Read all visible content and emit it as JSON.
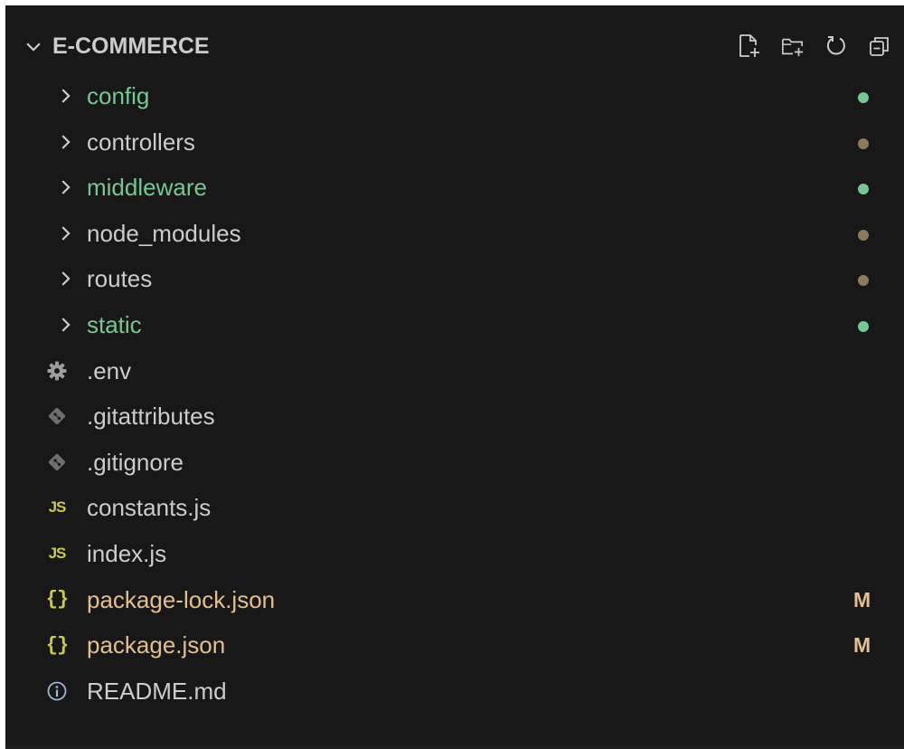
{
  "explorer": {
    "section_title": "E-COMMERCE",
    "actions": [
      {
        "name": "new-file-icon",
        "label": "New File"
      },
      {
        "name": "new-folder-icon",
        "label": "New Folder"
      },
      {
        "name": "refresh-icon",
        "label": "Refresh Explorer"
      },
      {
        "name": "collapse-all-icon",
        "label": "Collapse Folders"
      }
    ],
    "items": [
      {
        "label": "config",
        "type": "folder",
        "text_color": "#73c991",
        "decoration": "dot",
        "decoration_color": "#73c991"
      },
      {
        "label": "controllers",
        "type": "folder",
        "text_color": "#cccccc",
        "decoration": "dot",
        "decoration_color": "#8c7a5b"
      },
      {
        "label": "middleware",
        "type": "folder",
        "text_color": "#73c991",
        "decoration": "dot",
        "decoration_color": "#73c991"
      },
      {
        "label": "node_modules",
        "type": "folder",
        "text_color": "#cccccc",
        "decoration": "dot",
        "decoration_color": "#8c7a5b"
      },
      {
        "label": "routes",
        "type": "folder",
        "text_color": "#cccccc",
        "decoration": "dot",
        "decoration_color": "#8c7a5b"
      },
      {
        "label": "static",
        "type": "folder",
        "text_color": "#73c991",
        "decoration": "dot",
        "decoration_color": "#73c991"
      },
      {
        "label": ".env",
        "type": "file",
        "icon": "gear-icon",
        "text_color": "#cccccc"
      },
      {
        "label": ".gitattributes",
        "type": "file",
        "icon": "git-icon",
        "text_color": "#cccccc"
      },
      {
        "label": ".gitignore",
        "type": "file",
        "icon": "git-icon",
        "text_color": "#cccccc"
      },
      {
        "label": "constants.js",
        "type": "file",
        "icon": "js-icon",
        "icon_text": "JS",
        "text_color": "#cccccc"
      },
      {
        "label": "index.js",
        "type": "file",
        "icon": "js-icon",
        "icon_text": "JS",
        "text_color": "#cccccc"
      },
      {
        "label": "package-lock.json",
        "type": "file",
        "icon": "json-icon",
        "icon_text": "{}",
        "text_color": "#e2c08d",
        "decoration": "badge",
        "badge": "M",
        "decoration_color": "#e2c08d"
      },
      {
        "label": "package.json",
        "type": "file",
        "icon": "json-icon",
        "icon_text": "{}",
        "text_color": "#e2c08d",
        "decoration": "badge",
        "badge": "M",
        "decoration_color": "#e2c08d"
      },
      {
        "label": "README.md",
        "type": "file",
        "icon": "info-icon",
        "text_color": "#cccccc"
      }
    ]
  },
  "colors": {
    "background": "#181818",
    "text": "#cccccc",
    "untracked_green": "#73c991",
    "modified_yellow": "#e2c08d",
    "ignored_dot": "#8c7a5b",
    "js_yellow": "#cbcb41",
    "icon_gray": "#9d9d9d"
  }
}
